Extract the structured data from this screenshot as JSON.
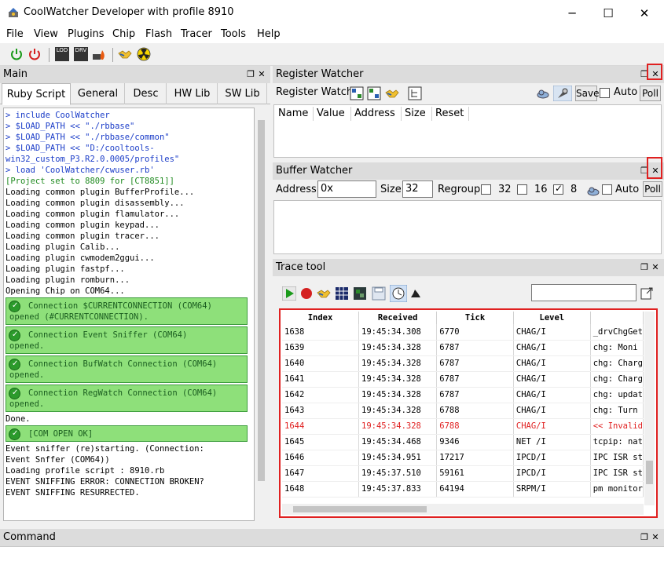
{
  "window": {
    "title": "CoolWatcher Developer with profile 8910",
    "minimize": "─",
    "maximize": "☐",
    "close": "✕"
  },
  "menu": [
    "File",
    "View",
    "Plugins",
    "Chip",
    "Flash",
    "Tracer",
    "Tools",
    "Help"
  ],
  "toolbar": {
    "icons": [
      "power-on-icon",
      "power-off-icon",
      "lod-icon",
      "drv-icon",
      "burn-icon",
      "handshake-icon",
      "radiation-icon"
    ],
    "lod_label": "LOD",
    "drv_label": "DRV"
  },
  "main": {
    "title": "Main",
    "tabs": [
      "Ruby Script",
      "General",
      "Desc",
      "HW Lib",
      "SW Lib"
    ],
    "console": [
      {
        "t": "> include CoolWatcher",
        "c": "blue"
      },
      {
        "t": "> $LOAD_PATH << \"./rbbase\"",
        "c": "blue"
      },
      {
        "t": "> $LOAD_PATH << \"./rbbase/common\"",
        "c": "blue"
      },
      {
        "t": "> $LOAD_PATH << \"D:/cooltools-",
        "c": "blue"
      },
      {
        "t": "win32_custom_P3.R2.0.0005/profiles\"",
        "c": "blue"
      },
      {
        "t": "> load 'CoolWatcher/cwuser.rb'",
        "c": "blue"
      },
      {
        "t": "[Project set to 8809 for [CT8851]]",
        "c": "green"
      },
      {
        "t": "Loading common plugin BufferProfile...",
        "c": ""
      },
      {
        "t": "Loading common plugin disassembly...",
        "c": ""
      },
      {
        "t": "Loading common plugin flamulator...",
        "c": ""
      },
      {
        "t": "Loading common plugin keypad...",
        "c": ""
      },
      {
        "t": "Loading common plugin tracer...",
        "c": ""
      },
      {
        "t": "Loading plugin Calib...",
        "c": ""
      },
      {
        "t": "Loading plugin cwmodem2ggui...",
        "c": ""
      },
      {
        "t": "Loading plugin fastpf...",
        "c": ""
      },
      {
        "t": "Loading plugin romburn...",
        "c": ""
      },
      {
        "t": "Opening Chip on COM64...",
        "c": ""
      }
    ],
    "ok_boxes": [
      {
        "l1": "Connection $CURRENTCONNECTION (COM64)",
        "l2": "opened (#CURRENTCONNECTION)."
      },
      {
        "l1": "Connection Event Sniffer (COM64)",
        "l2": "opened."
      },
      {
        "l1": "Connection BufWatch Connection (COM64)",
        "l2": "opened."
      },
      {
        "l1": "Connection RegWatch Connection (COM64)",
        "l2": "opened."
      }
    ],
    "done": "Done.",
    "com_open": "[COM OPEN OK]",
    "tail": [
      "Event sniffer (re)starting. (Connection:",
      "Event Snffer (COM64))",
      "Loading profile script : 8910.rb",
      "EVENT SNIFFING ERROR: CONNECTION BROKEN?",
      "EVENT SNIFFING RESURRECTED."
    ]
  },
  "register_watcher": {
    "title": "Register Watcher",
    "label": "Register Watch",
    "save": "Save",
    "auto": "Auto",
    "poll": "Poll",
    "columns": [
      "Name",
      "Value",
      "Address",
      "Size",
      "Reset"
    ]
  },
  "buffer_watcher": {
    "title": "Buffer Watcher",
    "address_label": "Address",
    "address_value": "0x",
    "size_label": "Size",
    "size_value": "32",
    "regroup_label": "Regroup",
    "opt32": "32",
    "opt16": "16",
    "opt8": "8",
    "auto": "Auto",
    "poll": "Poll"
  },
  "trace_tool": {
    "title": "Trace tool",
    "columns": [
      "Index",
      "Received",
      "Tick",
      "Level",
      ""
    ],
    "rows": [
      {
        "i": "1638",
        "r": "19:45:34.308",
        "t": "6770",
        "l": "CHAG/I",
        "m": "_drvChgGet",
        "err": false
      },
      {
        "i": "1639",
        "r": "19:45:34.328",
        "t": "6787",
        "l": "CHAG/I",
        "m": "chg:  Moni",
        "err": false
      },
      {
        "i": "1640",
        "r": "19:45:34.328",
        "t": "6787",
        "l": "CHAG/I",
        "m": "chg: Charg",
        "err": false
      },
      {
        "i": "1641",
        "r": "19:45:34.328",
        "t": "6787",
        "l": "CHAG/I",
        "m": "chg: Charg",
        "err": false
      },
      {
        "i": "1642",
        "r": "19:45:34.328",
        "t": "6787",
        "l": "CHAG/I",
        "m": "chg: updat",
        "err": false
      },
      {
        "i": "1643",
        "r": "19:45:34.328",
        "t": "6788",
        "l": "CHAG/I",
        "m": "chg: Turn",
        "err": false
      },
      {
        "i": "1644",
        "r": "19:45:34.328",
        "t": "6788",
        "l": "CHAG/I",
        "m": "<< Invalid",
        "err": true
      },
      {
        "i": "1645",
        "r": "19:45:34.468",
        "t": "9346",
        "l": "NET /I",
        "m": "tcpip: nat",
        "err": false
      },
      {
        "i": "1646",
        "r": "19:45:34.951",
        "t": "17217",
        "l": "IPCD/I",
        "m": "IPC ISR st",
        "err": false
      },
      {
        "i": "1647",
        "r": "19:45:37.510",
        "t": "59161",
        "l": "IPCD/I",
        "m": "IPC ISR st",
        "err": false
      },
      {
        "i": "1648",
        "r": "19:45:37.833",
        "t": "64194",
        "l": "SRPM/I",
        "m": "pm monitor",
        "err": false
      }
    ]
  },
  "command": {
    "title": "Command"
  }
}
